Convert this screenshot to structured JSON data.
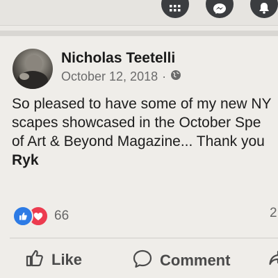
{
  "top_bar": {
    "icons": [
      "grid-menu-icon",
      "messenger-icon",
      "bell-icon"
    ]
  },
  "post": {
    "author": "Nicholas Teetelli",
    "date": "October 12, 2018",
    "separator": "·",
    "privacy_icon": "globe-icon",
    "text_lines": [
      "So pleased to have some of my new NY",
      "scapes showcased in the October Spe",
      "of Art & Beyond Magazine... Thank you"
    ],
    "tagged_name": "Ryk"
  },
  "reactions": {
    "icons": [
      "like-reaction-icon",
      "love-reaction-icon"
    ],
    "count": "66",
    "comments_count": "2"
  },
  "actions": {
    "like_label": "Like",
    "comment_label": "Comment"
  },
  "colors": {
    "like_blue": "#2d7be5",
    "love_red": "#ec3b4f",
    "background": "#efede9"
  }
}
